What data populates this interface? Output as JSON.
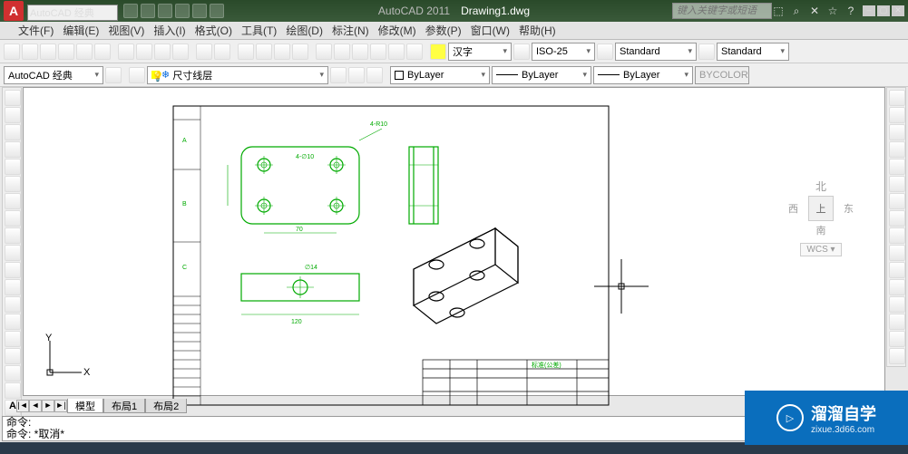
{
  "app": {
    "logo": "A",
    "name": "AutoCAD 2011",
    "doc": "Drawing1.dwg"
  },
  "title": {
    "workspace": "AutoCAD 经典",
    "search_placeholder": "键入关键字或短语"
  },
  "menus": [
    "文件(F)",
    "编辑(E)",
    "视图(V)",
    "插入(I)",
    "格式(O)",
    "工具(T)",
    "绘图(D)",
    "标注(N)",
    "修改(M)",
    "参数(P)",
    "窗口(W)",
    "帮助(H)"
  ],
  "toolbar2": {
    "workspace": "AutoCAD 经典",
    "layer": "尺寸线层",
    "font": "汉字",
    "dimstyle": "ISO-25",
    "std1": "Standard",
    "std2": "Standard"
  },
  "toolbar3": {
    "linetype1": "ByLayer",
    "linetype2": "ByLayer",
    "linetype3": "ByLayer",
    "color": "BYCOLOR"
  },
  "tabs": {
    "l": "◄",
    "r": "►",
    "items": [
      "模型",
      "布局1",
      "布局2"
    ],
    "active": 0
  },
  "cmd": {
    "l1": "命令:",
    "l2": "命令: *取消*"
  },
  "viewcube": {
    "n": "北",
    "w": "西",
    "e": "东",
    "s": "南",
    "top": "上",
    "wcs": "WCS ▾"
  },
  "ucs": {
    "x": "X",
    "y": "Y"
  },
  "watermark": {
    "text": "溜溜自学",
    "sub": "zixue.3d66.com"
  },
  "drawing": {
    "dims": {
      "w": "70",
      "r1": "4-R10",
      "d1": "4-∅10",
      "d2": "∅14",
      "h": "120"
    },
    "titleblock": {
      "t": "标准(公差)"
    }
  }
}
